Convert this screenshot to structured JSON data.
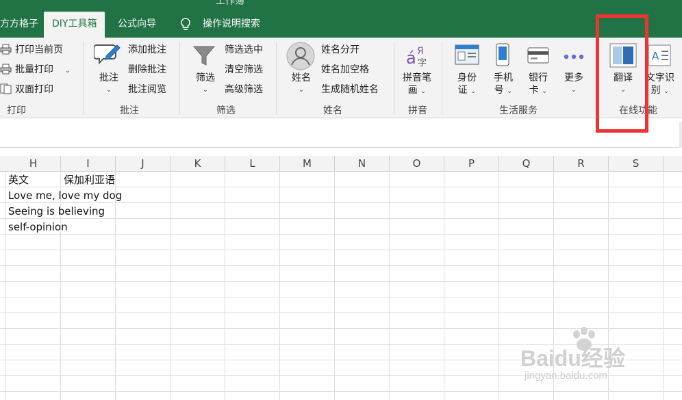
{
  "titlebar": {
    "partial_title": "工作簿"
  },
  "tabs": [
    {
      "label": "方方格子"
    },
    {
      "label": "DIY工具箱"
    },
    {
      "label": "公式向导"
    },
    {
      "label": "操作说明搜索"
    }
  ],
  "ribbon": {
    "print": {
      "print_current_page": "打印当前页",
      "batch_print": "批量打印",
      "duplex_print": "双面打印",
      "group": "打印"
    },
    "comment": {
      "big": "批注",
      "add": "添加批注",
      "delete": "删除批注",
      "read": "批注阅览",
      "group": "批注"
    },
    "filter": {
      "big": "筛选",
      "selected": "筛选选中",
      "clear": "清空筛选",
      "advanced": "高级筛选",
      "group": "筛选"
    },
    "name": {
      "big": "姓名",
      "split": "姓名分开",
      "add_space": "姓名加空格",
      "random": "生成随机姓名",
      "group": "姓名"
    },
    "pinyin": {
      "big_line1": "拼音笔",
      "big_line2": "画",
      "group": "拼音"
    },
    "life": {
      "id_line1": "身份",
      "id_line2": "证",
      "phone_line1": "手机",
      "phone_line2": "号",
      "bank_line1": "银行",
      "bank_line2": "卡",
      "more": "更多",
      "group": "生活服务"
    },
    "online": {
      "translate": "翻译",
      "ocr_line1": "文字识",
      "ocr_line2": "别",
      "group": "在线功能"
    }
  },
  "sheet": {
    "columns": [
      "H",
      "I",
      "J",
      "K",
      "L",
      "M",
      "N",
      "O",
      "P",
      "Q",
      "R",
      "S"
    ],
    "cells": {
      "h_header": "英文",
      "i_header": "保加利亚语",
      "row2": "Love me, love my dog",
      "row3": "Seeing is believing",
      "row4": "self-opinion"
    }
  },
  "watermark": {
    "brand": "Baidu经验",
    "url": "jingyan.baidu.com"
  }
}
